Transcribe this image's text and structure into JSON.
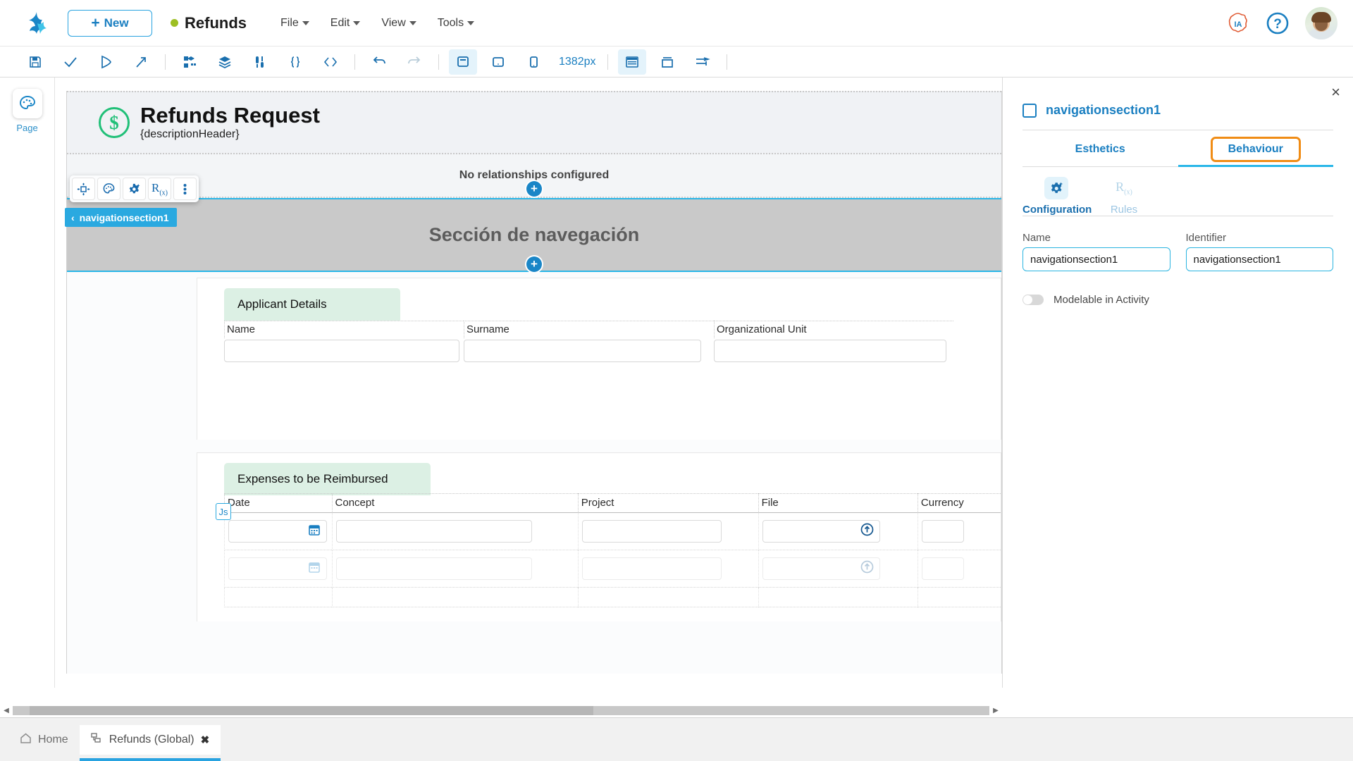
{
  "topbar": {
    "logo_icon": "bonita-logo-icon",
    "new_button": "New",
    "document_title": "Refunds",
    "status_dot_color": "#9dbf23",
    "menus": [
      "File",
      "Edit",
      "View",
      "Tools"
    ],
    "ia_badge": "IA",
    "help_badge": "?",
    "avatar": "user-avatar"
  },
  "toolbar": {
    "zoom_value": "1382px",
    "buttons": [
      {
        "name": "save-icon"
      },
      {
        "name": "validate-check-icon"
      },
      {
        "name": "run-play-icon"
      },
      {
        "name": "export-share-icon"
      },
      {
        "name": "widgets-grid-icon"
      },
      {
        "name": "layers-stack-icon"
      },
      {
        "name": "variables-icon"
      },
      {
        "name": "json-braces-icon"
      },
      {
        "name": "code-brackets-icon"
      },
      {
        "name": "undo-icon"
      },
      {
        "name": "redo-icon"
      },
      {
        "name": "desktop-preview-icon"
      },
      {
        "name": "tablet-preview-icon"
      },
      {
        "name": "mobile-preview-icon"
      },
      {
        "name": "container-panel-icon"
      },
      {
        "name": "modal-container-icon"
      },
      {
        "name": "form-container-icon"
      }
    ]
  },
  "leftrail": {
    "items": [
      {
        "icon": "palette-page-icon",
        "label": "Page"
      }
    ]
  },
  "canvas": {
    "header": {
      "icon": "dollar-coin-icon",
      "title": "Refunds Request",
      "subtitle": "{descriptionHeader}"
    },
    "float_toolbar": [
      {
        "name": "move-handle-icon"
      },
      {
        "name": "palette-esthetics-icon"
      },
      {
        "name": "gear-configuration-icon"
      },
      {
        "name": "rules-rx-icon"
      },
      {
        "name": "more-options-icon"
      }
    ],
    "selection_tag": {
      "chevron": "‹",
      "label": "navigationsection1"
    },
    "relationships_message": "No relationships configured",
    "navigation_section_label": "Sección de navegación",
    "add_node_label": "+",
    "applicant_group": {
      "title": "Applicant Details",
      "fields": [
        "Name",
        "Surname",
        "Organizational Unit"
      ]
    },
    "expenses_group": {
      "title": "Expenses to be Reimbursed",
      "columns": [
        "Date",
        "Concept",
        "Project",
        "File",
        "Currency"
      ],
      "js_badge": "Js",
      "row_icons": {
        "date": "calendar-icon",
        "file": "upload-circle-icon"
      }
    }
  },
  "rightpanel": {
    "close_label": "×",
    "widget_name": "navigationsection1",
    "tabs": [
      {
        "label": "Esthetics",
        "active": false
      },
      {
        "label": "Behaviour",
        "active": true,
        "highlighted": true
      }
    ],
    "subtabs": [
      {
        "label": "Configuration",
        "icon": "gear-sparkle-icon",
        "active": true
      },
      {
        "label": "Rules",
        "icon": "rules-rx-icon",
        "active": false
      }
    ],
    "fields": [
      {
        "label": "Name",
        "value": "navigationsection1"
      },
      {
        "label": "Identifier",
        "value": "navigationsection1"
      }
    ],
    "toggle": {
      "label": "Modelable in Activity",
      "on": false
    },
    "accent_color": "#1a7fc1",
    "highlight_color": "#f08c15"
  },
  "bottom": {
    "tabs": [
      {
        "label": "Home",
        "icon": "home-icon",
        "active": false,
        "closable": false
      },
      {
        "label": "Refunds (Global)",
        "icon": "diagram-icon",
        "active": true,
        "closable": true,
        "close": "✖"
      }
    ]
  }
}
